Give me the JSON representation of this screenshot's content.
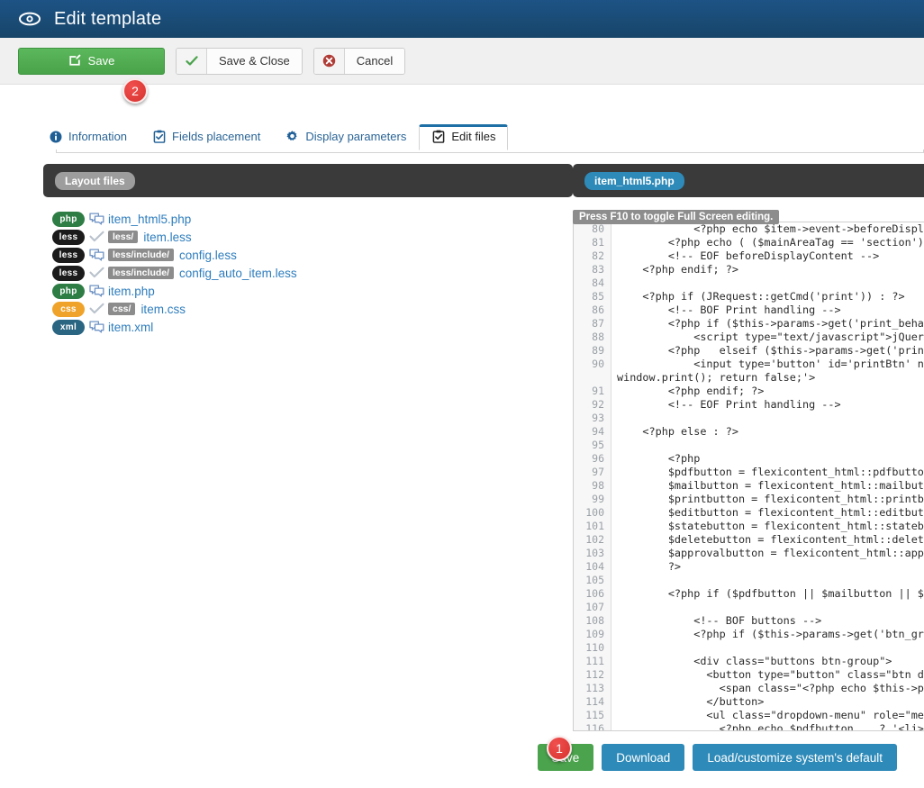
{
  "header": {
    "title": "Edit template",
    "icon": "eye-icon"
  },
  "toolbar": {
    "save_label": "Save",
    "save_icon": "edit-square-icon",
    "save_close_label": "Save & Close",
    "save_close_icon": "check-icon",
    "cancel_label": "Cancel",
    "cancel_icon": "circle-x-icon"
  },
  "markers": {
    "one": "1",
    "two": "2"
  },
  "tabs": [
    {
      "label": "Information",
      "icon": "info-circle-icon",
      "active": false
    },
    {
      "label": "Fields placement",
      "icon": "clipboard-check-icon",
      "active": false
    },
    {
      "label": "Display parameters",
      "icon": "gear-icon",
      "active": false
    },
    {
      "label": "Edit files",
      "icon": "clipboard-check-icon",
      "active": true
    }
  ],
  "layout_panel": {
    "title": "Layout files",
    "files": [
      {
        "lang": "php",
        "lang_class": "lang-php",
        "state_icon": "speech-bubbles-icon",
        "path": "",
        "name": "item_html5.php"
      },
      {
        "lang": "less",
        "lang_class": "lang-less",
        "state_icon": "check-icon",
        "path": "less/",
        "name": "item.less"
      },
      {
        "lang": "less",
        "lang_class": "lang-less",
        "state_icon": "speech-bubbles-icon",
        "path": "less/include/",
        "name": "config.less"
      },
      {
        "lang": "less",
        "lang_class": "lang-less",
        "state_icon": "check-icon",
        "path": "less/include/",
        "name": "config_auto_item.less"
      },
      {
        "lang": "php",
        "lang_class": "lang-php",
        "state_icon": "speech-bubbles-icon",
        "path": "",
        "name": "item.php"
      },
      {
        "lang": "css",
        "lang_class": "lang-css",
        "state_icon": "check-icon",
        "path": "css/",
        "name": "item.css"
      },
      {
        "lang": "xml",
        "lang_class": "lang-xml",
        "state_icon": "speech-bubbles-icon",
        "path": "",
        "name": "item.xml"
      }
    ]
  },
  "editor_panel": {
    "title": "item_html5.php",
    "fullscreen_hint": "Press F10 to toggle Full Screen editing.",
    "first_visible_line": 80,
    "lines": [
      {
        "n": "80",
        "text": "            <?php echo $item->event->beforeDisplay"
      },
      {
        "n": "81",
        "text": "        <?php echo ( ($mainAreaTag == 'section')"
      },
      {
        "n": "82",
        "text": "        <!-- EOF beforeDisplayContent -->"
      },
      {
        "n": "83",
        "text": "    <?php endif; ?>"
      },
      {
        "n": "84",
        "text": ""
      },
      {
        "n": "85",
        "text": "    <?php if (JRequest::getCmd('print')) : ?>"
      },
      {
        "n": "86",
        "text": "        <!-- BOF Print handling -->"
      },
      {
        "n": "87",
        "text": "        <?php if ($this->params->get('print_behav"
      },
      {
        "n": "88",
        "text": "            <script type=\"text/javascript\">jQuery"
      },
      {
        "n": "89",
        "text": "        <?php   elseif ($this->params->get('print"
      },
      {
        "n": "90",
        "text": "            <input type='button' id='printBtn' na"
      },
      {
        "n": "",
        "text": "window.print(); return false;'>"
      },
      {
        "n": "91",
        "text": "        <?php endif; ?>"
      },
      {
        "n": "92",
        "text": "        <!-- EOF Print handling -->"
      },
      {
        "n": "93",
        "text": ""
      },
      {
        "n": "94",
        "text": "    <?php else : ?>"
      },
      {
        "n": "95",
        "text": ""
      },
      {
        "n": "96",
        "text": "        <?php"
      },
      {
        "n": "97",
        "text": "        $pdfbutton = flexicontent_html::pdfbutton"
      },
      {
        "n": "98",
        "text": "        $mailbutton = flexicontent_html::mailbutt"
      },
      {
        "n": "99",
        "text": "        $printbutton = flexicontent_html::printbu"
      },
      {
        "n": "100",
        "text": "        $editbutton = flexicontent_html::editbutt"
      },
      {
        "n": "101",
        "text": "        $statebutton = flexicontent_html::statebu"
      },
      {
        "n": "102",
        "text": "        $deletebutton = flexicontent_html::delete"
      },
      {
        "n": "103",
        "text": "        $approvalbutton = flexicontent_html::appr"
      },
      {
        "n": "104",
        "text": "        ?>"
      },
      {
        "n": "105",
        "text": ""
      },
      {
        "n": "106",
        "text": "        <?php if ($pdfbutton || $mailbutton || $p"
      },
      {
        "n": "107",
        "text": ""
      },
      {
        "n": "108",
        "text": "            <!-- BOF buttons -->"
      },
      {
        "n": "109",
        "text": "            <?php if ($this->params->get('btn_grp"
      },
      {
        "n": "110",
        "text": ""
      },
      {
        "n": "111",
        "text": "            <div class=\"buttons btn-group\">"
      },
      {
        "n": "112",
        "text": "              <button type=\"button\" class=\"btn dr"
      },
      {
        "n": "113",
        "text": "                <span class=\"<?php echo $this->pa"
      },
      {
        "n": "114",
        "text": "              </button>"
      },
      {
        "n": "115",
        "text": "              <ul class=\"dropdown-menu\" role=\"men"
      },
      {
        "n": "116",
        "text": "                <?php echo $pdfbutton    ? '<li>'"
      }
    ]
  },
  "bottom_actions": [
    {
      "label": "Save",
      "style": "green"
    },
    {
      "label": "Download",
      "style": "blue"
    },
    {
      "label": "Load/customize system's default",
      "style": "blue"
    }
  ],
  "colors": {
    "header_bg": "#1a4e7f",
    "save_green": "#4ba34d",
    "action_blue": "#2e8ab8",
    "marker_red": "#d6322f",
    "link_blue": "#2e7dbd",
    "dark_panel": "#3a3a3a"
  }
}
